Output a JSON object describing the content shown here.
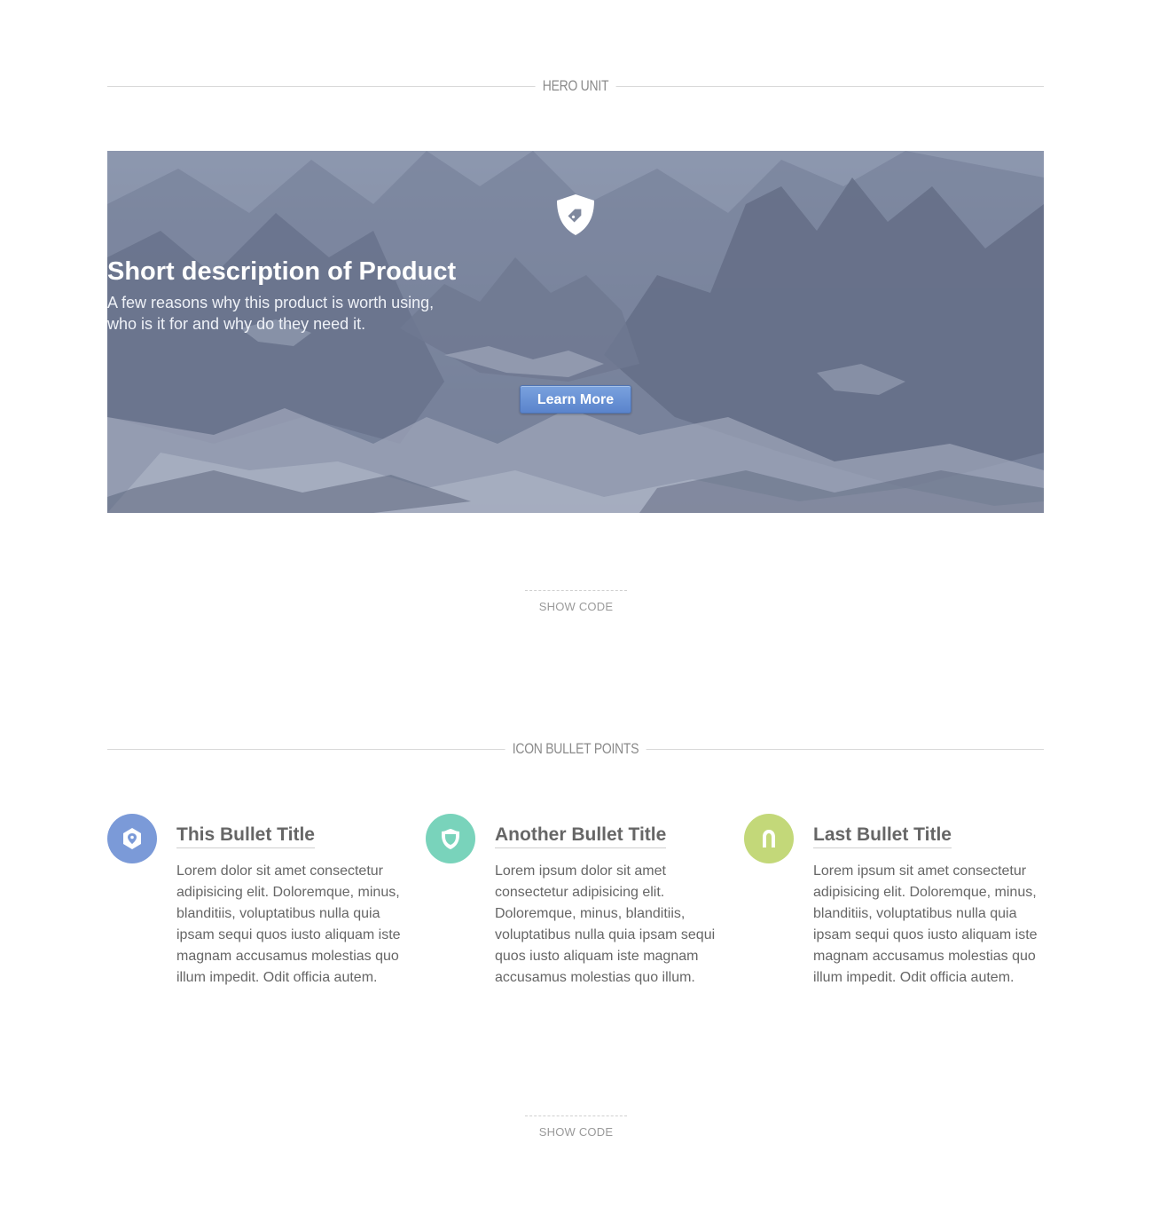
{
  "sections": {
    "hero_header": "HERO UNIT",
    "bullets_header": "ICON BULLET POINTS"
  },
  "hero": {
    "badge_icon": "shield-tag-icon",
    "title": "Short description of Product",
    "subtitle_line1": "A few reasons why this product is worth using,",
    "subtitle_line2": "who is it for and why do they need it.",
    "cta_label": "Learn More"
  },
  "show_code_1": "SHOW CODE",
  "show_code_2": "SHOW CODE",
  "bullets": [
    {
      "icon": "location-pin-icon",
      "color": "#7b9ad8",
      "title": "This Bullet Title",
      "text": "Lorem dolor sit amet consectetur adipisicing elit. Doloremque, minus, blanditiis, voluptatibus nulla quia ipsam sequi quos iusto aliquam iste magnam accusamus molestias quo illum impedit. Odit officia autem."
    },
    {
      "icon": "badge-shield-icon",
      "color": "#79d3bb",
      "title": "Another Bullet Title",
      "text": "Lorem ipsum dolor sit amet consectetur adipisicing elit. Doloremque, minus, blanditiis, voluptatibus nulla quia ipsam sequi quos iusto aliquam iste magnam accusamus molestias quo illum."
    },
    {
      "icon": "horseshoe-icon",
      "color": "#c3d879",
      "title": "Last Bullet Title",
      "text": "Lorem ipsum sit amet consectetur adipisicing elit. Doloremque, minus, blanditiis, voluptatibus nulla quia ipsam sequi quos iusto aliquam iste magnam accusamus molestias quo illum impedit. Odit officia autem."
    }
  ]
}
